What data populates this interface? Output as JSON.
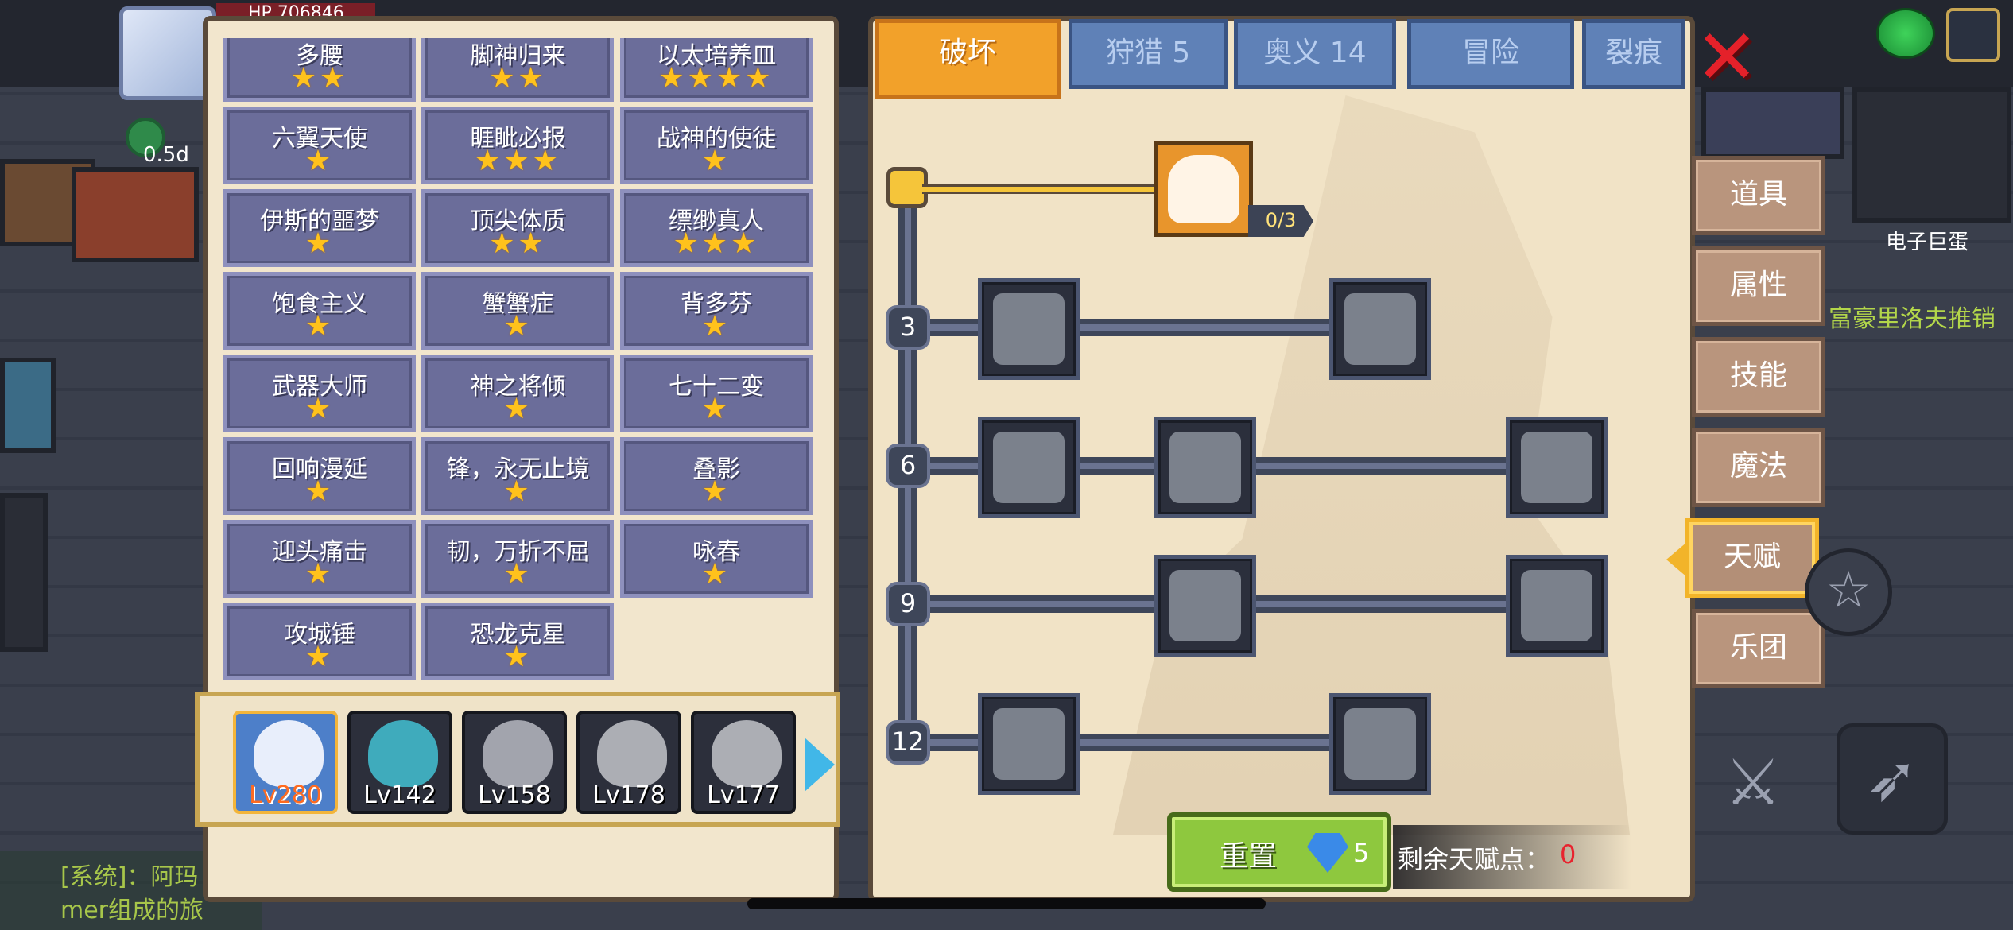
{
  "hud": {
    "hp_label": "HP",
    "hp_value": "706846",
    "exp_text": "0.5d"
  },
  "chat": {
    "line1": "[系统]：阿玛",
    "line2": "mer组成的旅"
  },
  "scene": {
    "map_label": "电子巨蛋",
    "npc_text": "富豪里洛夫推销"
  },
  "talent_list": [
    {
      "name": "多腰",
      "stars": "★★"
    },
    {
      "name": "脚神归来",
      "stars": "★★"
    },
    {
      "name": "以太培养皿",
      "stars": "★★★★"
    },
    {
      "name": "六翼天使",
      "stars": "★"
    },
    {
      "name": "睚眦必报",
      "stars": "★★★"
    },
    {
      "name": "战神的使徒",
      "stars": "★"
    },
    {
      "name": "伊斯的噩梦",
      "stars": "★"
    },
    {
      "name": "顶尖体质",
      "stars": "★★"
    },
    {
      "name": "缥缈真人",
      "stars": "★★★"
    },
    {
      "name": "饱食主义",
      "stars": "★"
    },
    {
      "name": "蟹蟹症",
      "stars": "★"
    },
    {
      "name": "背多芬",
      "stars": "★"
    },
    {
      "name": "武器大师",
      "stars": "★"
    },
    {
      "name": "神之将倾",
      "stars": "★"
    },
    {
      "name": "七十二变",
      "stars": "★"
    },
    {
      "name": "回响漫延",
      "stars": "★"
    },
    {
      "name": "锋，永无止境",
      "stars": "★"
    },
    {
      "name": "叠影",
      "stars": "★"
    },
    {
      "name": "迎头痛击",
      "stars": "★"
    },
    {
      "name": "韧，万折不屈",
      "stars": "★"
    },
    {
      "name": "咏春",
      "stars": "★"
    },
    {
      "name": "攻城锤",
      "stars": "★"
    },
    {
      "name": "恐龙克星",
      "stars": "★"
    }
  ],
  "characters": [
    {
      "level": "Lv280",
      "selected": true
    },
    {
      "level": "Lv142",
      "selected": false
    },
    {
      "level": "Lv158",
      "selected": false
    },
    {
      "level": "Lv178",
      "selected": false
    },
    {
      "level": "Lv177",
      "selected": false
    }
  ],
  "tabs": [
    {
      "label": "破坏",
      "active": true
    },
    {
      "label": "狩猎 5",
      "active": false
    },
    {
      "label": "奥义 14",
      "active": false
    },
    {
      "label": "冒险",
      "active": false
    },
    {
      "label": "裂痕",
      "active": false
    }
  ],
  "tree": {
    "root_counter": "0/3",
    "levels": [
      "3",
      "6",
      "9",
      "12"
    ],
    "icons": [
      {
        "name": "arm-wrestle",
        "row": 0
      },
      {
        "name": "muscle-body",
        "row": 1
      },
      {
        "name": "arrow-pierce",
        "row": 1
      },
      {
        "name": "shield-break",
        "row": 2
      },
      {
        "name": "fist-punch",
        "row": 2
      },
      {
        "name": "blade-slash",
        "row": 2
      },
      {
        "name": "ground-ripple",
        "row": 3
      },
      {
        "name": "bat-wing",
        "row": 3
      },
      {
        "name": "clenched-fist",
        "row": 4
      },
      {
        "name": "open-palm",
        "row": 4
      }
    ]
  },
  "reset": {
    "label": "重置",
    "cost": "5"
  },
  "points": {
    "label": "剩余天赋点：",
    "value": "0"
  },
  "side_menu": [
    {
      "label": "道具",
      "active": false
    },
    {
      "label": "属性",
      "active": false
    },
    {
      "label": "技能",
      "active": false
    },
    {
      "label": "魔法",
      "active": false
    },
    {
      "label": "天赋",
      "active": true
    },
    {
      "label": "乐团",
      "active": false
    }
  ],
  "colors": {
    "accent": "#f2a12a",
    "tab_inactive": "#5f81b7",
    "star": "#ffc21c",
    "points_value": "#e8232e",
    "reset": "#8ec83e"
  }
}
